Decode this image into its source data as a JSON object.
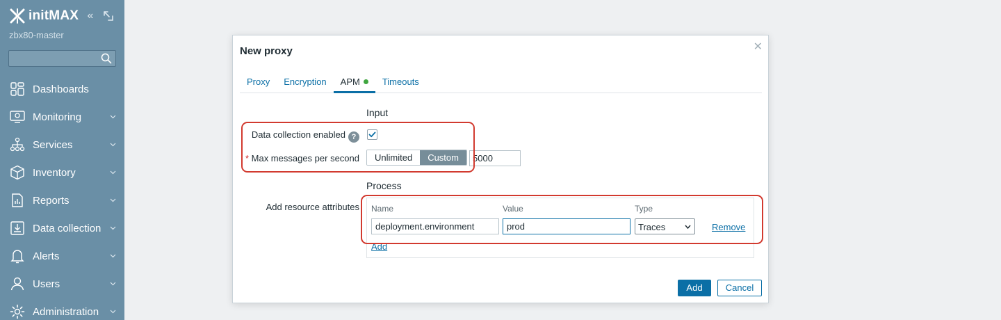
{
  "app": {
    "brand": "initMAX",
    "server": "zbx80-master"
  },
  "sidebar": {
    "search_placeholder": "",
    "items": [
      {
        "label": "Dashboards",
        "icon": "dashboards-icon"
      },
      {
        "label": "Monitoring",
        "icon": "monitoring-icon"
      },
      {
        "label": "Services",
        "icon": "services-icon"
      },
      {
        "label": "Inventory",
        "icon": "inventory-icon"
      },
      {
        "label": "Reports",
        "icon": "reports-icon"
      },
      {
        "label": "Data collection",
        "icon": "data-collection-icon"
      },
      {
        "label": "Alerts",
        "icon": "alerts-icon"
      },
      {
        "label": "Users",
        "icon": "users-icon"
      },
      {
        "label": "Administration",
        "icon": "administration-icon"
      }
    ]
  },
  "dialog": {
    "title": "New proxy",
    "tabs": [
      {
        "label": "Proxy",
        "active": false
      },
      {
        "label": "Encryption",
        "active": false
      },
      {
        "label": "APM",
        "active": true,
        "indicator": "green-dot"
      },
      {
        "label": "Timeouts",
        "active": false
      }
    ],
    "input_section": {
      "heading": "Input",
      "data_collection_label": "Data collection enabled",
      "data_collection_enabled": true,
      "max_messages_label": "Max messages per second",
      "required_mark": "*",
      "segments": [
        "Unlimited",
        "Custom"
      ],
      "selected_segment": "Custom",
      "max_messages_value": "5000"
    },
    "process_section": {
      "heading": "Process",
      "attributes_label": "Add resource attributes",
      "columns": {
        "name": "Name",
        "value": "Value",
        "type": "Type"
      },
      "row": {
        "name": "deployment.environment",
        "value": "prod",
        "type": "Traces"
      },
      "remove_label": "Remove",
      "add_label": "Add"
    },
    "buttons": {
      "primary": "Add",
      "secondary": "Cancel"
    }
  },
  "colors": {
    "accent": "#0b6fa6",
    "sidebar": "#6a8fa6",
    "highlight": "#d23a2f",
    "status_ok": "#3fa63f"
  }
}
